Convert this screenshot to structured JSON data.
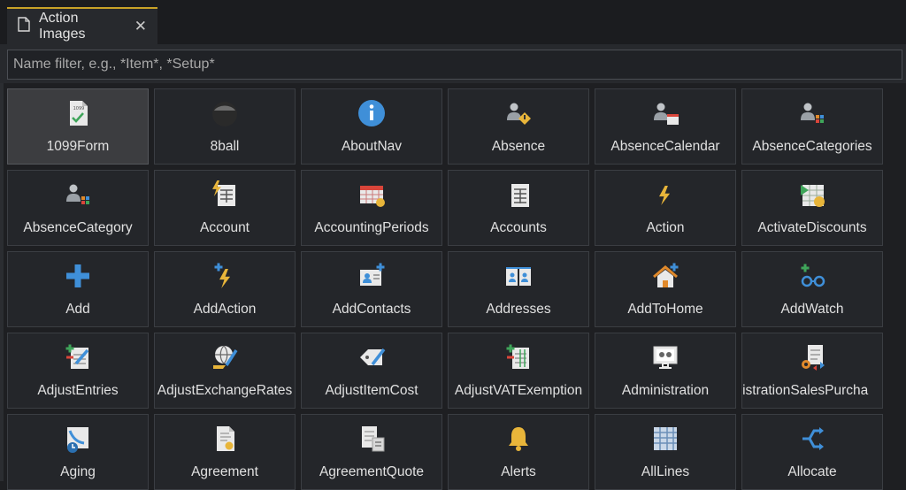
{
  "tab": {
    "title": "Action Images",
    "close": "✕",
    "accent": "#c9a227"
  },
  "filter": {
    "placeholder": "Name filter, e.g., *Item*, *Setup*",
    "value": ""
  },
  "tiles": [
    {
      "label": "1099Form",
      "icon": "form-1099-icon",
      "selected": true
    },
    {
      "label": "8ball",
      "icon": "8ball-icon"
    },
    {
      "label": "AboutNav",
      "icon": "info-icon"
    },
    {
      "label": "Absence",
      "icon": "absence-icon"
    },
    {
      "label": "AbsenceCalendar",
      "icon": "absence-calendar-icon"
    },
    {
      "label": "AbsenceCategories",
      "icon": "absence-categories-icon"
    },
    {
      "label": "AbsenceCategory",
      "icon": "absence-category-icon"
    },
    {
      "label": "Account",
      "icon": "account-icon"
    },
    {
      "label": "AccountingPeriods",
      "icon": "accounting-periods-icon"
    },
    {
      "label": "Accounts",
      "icon": "accounts-icon"
    },
    {
      "label": "Action",
      "icon": "lightning-icon"
    },
    {
      "label": "ActivateDiscounts",
      "icon": "activate-discounts-icon"
    },
    {
      "label": "Add",
      "icon": "plus-icon"
    },
    {
      "label": "AddAction",
      "icon": "add-action-icon"
    },
    {
      "label": "AddContacts",
      "icon": "add-contacts-icon"
    },
    {
      "label": "Addresses",
      "icon": "addresses-icon"
    },
    {
      "label": "AddToHome",
      "icon": "add-to-home-icon"
    },
    {
      "label": "AddWatch",
      "icon": "add-watch-icon"
    },
    {
      "label": "AdjustEntries",
      "icon": "adjust-entries-icon"
    },
    {
      "label": "AdjustExchangeRates",
      "icon": "adjust-exchange-rates-icon"
    },
    {
      "label": "AdjustItemCost",
      "icon": "adjust-item-cost-icon"
    },
    {
      "label": "AdjustVATExemption",
      "icon": "adjust-vat-exemption-icon"
    },
    {
      "label": "Administration",
      "icon": "administration-icon"
    },
    {
      "label": "inistrationSalesPurcha",
      "icon": "administration-sales-purchase-icon",
      "clip": true
    },
    {
      "label": "Aging",
      "icon": "aging-icon"
    },
    {
      "label": "Agreement",
      "icon": "agreement-icon"
    },
    {
      "label": "AgreementQuote",
      "icon": "agreement-quote-icon"
    },
    {
      "label": "Alerts",
      "icon": "bell-icon"
    },
    {
      "label": "AllLines",
      "icon": "all-lines-icon"
    },
    {
      "label": "Allocate",
      "icon": "allocate-icon"
    }
  ]
}
